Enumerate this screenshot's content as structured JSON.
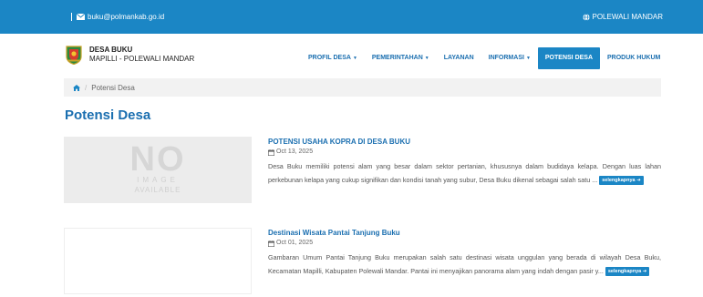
{
  "topbar": {
    "email": "buku@polmankab.go.id",
    "region": "POLEWALI MANDAR"
  },
  "brand": {
    "title": "DESA BUKU",
    "subtitle": "MAPILLI - POLEWALI MANDAR"
  },
  "nav": {
    "profil": "PROFIL DESA",
    "pemerintahan": "PEMERINTAHAN",
    "layanan": "LAYANAN",
    "informasi": "INFORMASI",
    "potensi": "POTENSI DESA",
    "produk": "PRODUK HUKUM"
  },
  "breadcrumb": {
    "current": "Potensi Desa"
  },
  "page": {
    "title": "Potensi Desa"
  },
  "posts": [
    {
      "title": "POTENSI USAHA KOPRA DI DESA BUKU",
      "date": "Oct 13, 2025",
      "excerpt": "Desa Buku memiliki potensi alam yang besar dalam sektor pertanian, khususnya dalam budidaya kelapa. Dengan luas lahan perkebunan kelapa yang cukup signifikan dan kondisi tanah yang subur, Desa Buku dikenal sebagai salah satu ...",
      "readmore": "selengkapnya",
      "thumb": {
        "line1": "NO",
        "line2": "IMAGE",
        "line3": "AVAILABLE"
      }
    },
    {
      "title": "Destinasi Wisata Pantai Tanjung Buku",
      "date": "Oct 01, 2025",
      "excerpt": "Gambaran Umum Pantai Tanjung Buku merupakan salah satu destinasi wisata unggulan yang berada di wilayah Desa Buku, Kecamatan Mapilli, Kabupaten Polewali Mandar. Pantai ini menyajikan panorama alam yang indah dengan pasir y...",
      "readmore": "selengkapnya"
    }
  ]
}
